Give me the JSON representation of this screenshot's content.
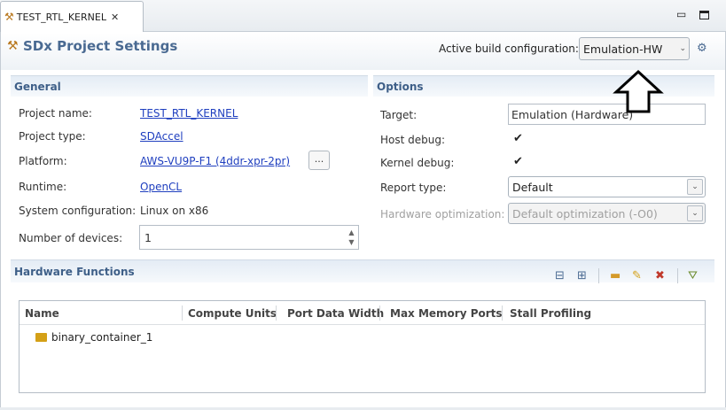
{
  "tab": {
    "title": "TEST_RTL_KERNEL",
    "close_glyph": "✕",
    "icon": "sdx-tools-icon"
  },
  "window_controls": {
    "minimize": "▭",
    "maximize": ""
  },
  "header": {
    "title": "SDx Project Settings",
    "build_config_label": "Active build configuration:",
    "build_config_value": "Emulation-HW"
  },
  "general": {
    "section_title": "General",
    "project_name_label": "Project name:",
    "project_name_value": "TEST_RTL_KERNEL",
    "project_type_label": "Project type:",
    "project_type_value": "SDAccel",
    "platform_label": "Platform:",
    "platform_value": "AWS-VU9P-F1 (4ddr-xpr-2pr)",
    "platform_browse": "...",
    "runtime_label": "Runtime:",
    "runtime_value": "OpenCL",
    "sysconf_label": "System configuration:",
    "sysconf_value": "Linux on x86",
    "num_devices_label": "Number of devices:",
    "num_devices_value": "1"
  },
  "options": {
    "section_title": "Options",
    "target_label": "Target:",
    "target_value": "Emulation (Hardware)",
    "host_debug_label": "Host debug:",
    "host_debug_checked": true,
    "kernel_debug_label": "Kernel debug:",
    "kernel_debug_checked": true,
    "report_type_label": "Report type:",
    "report_type_value": "Default",
    "hw_opt_label": "Hardware optimization:",
    "hw_opt_value": "Default optimization (-O0)"
  },
  "hardware_functions": {
    "section_title": "Hardware Functions",
    "columns": [
      "Name",
      "Compute Units",
      "Port Data Width",
      "Max Memory Ports",
      "Stall Profiling"
    ],
    "rows": [
      {
        "name": "binary_container_1"
      }
    ]
  },
  "glyphs": {
    "check": "✔",
    "combo_arrow": "⌄",
    "spin_up": "▲",
    "spin_down": "▼",
    "collapse": "⊟",
    "expand": "⊞",
    "add": "▬",
    "key": "🔑",
    "delete": "✖",
    "run": "⛛",
    "gear": "⚙",
    "tools": "⚒"
  }
}
